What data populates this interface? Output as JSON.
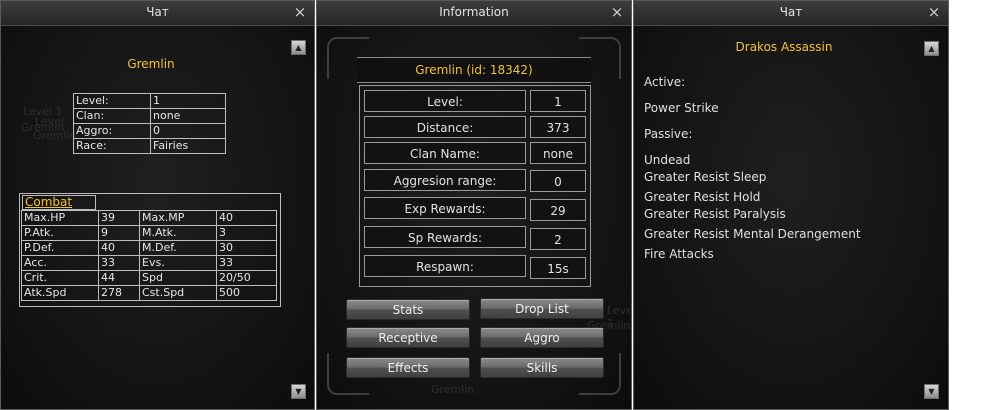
{
  "windows": {
    "left": {
      "title": "Чат",
      "close_icon": "×",
      "monster_name": "Gremlin",
      "info": [
        [
          "Level:",
          "1"
        ],
        [
          "Clan:",
          "none"
        ],
        [
          "Aggro:",
          "0"
        ],
        [
          "Race:",
          "Fairies"
        ]
      ],
      "combat_header": "Combat",
      "combat": [
        [
          "Max.HP",
          "39",
          "Max.MP",
          "40"
        ],
        [
          "P.Atk.",
          "9",
          "M.Atk.",
          "3"
        ],
        [
          "P.Def.",
          "40",
          "M.Def.",
          "30"
        ],
        [
          "Acc.",
          "33",
          "Evs.",
          "33"
        ],
        [
          "Crit.",
          "44",
          "Spd",
          "20/50"
        ],
        [
          "Atk.Spd",
          "278",
          "Cst.Spd",
          "500"
        ]
      ],
      "ghost_text": [
        "Level 1",
        "Level",
        "Gremlin",
        "Gremlin"
      ]
    },
    "middle": {
      "title": "Information",
      "header": "Gremlin (id: 18342)",
      "rows": [
        {
          "label": "Level:",
          "value": "1"
        },
        {
          "label": "Distance:",
          "value": "373"
        },
        {
          "label": "Clan Name:",
          "value": "none"
        },
        {
          "label": "Aggresion range:",
          "value": "0"
        },
        {
          "label": "Exp Rewards:",
          "value": "29"
        },
        {
          "label": "Sp Rewards:",
          "value": "2"
        },
        {
          "label": "Respawn:",
          "value": "15s"
        }
      ],
      "buttons": {
        "stats": "Stats",
        "drop_list": "Drop List",
        "receptive": "Receptive",
        "aggro": "Aggro",
        "effects": "Effects",
        "skills": "Skills"
      },
      "ghost_text": [
        "Gremlin",
        "Level 1",
        "Gremlin"
      ]
    },
    "right": {
      "title": "Чат",
      "monster_name": "Drakos Assassin",
      "lines": [
        "Active:",
        "Power Strike",
        "Passive:",
        "Undead",
        "Greater Resist Sleep",
        "Greater Resist Hold",
        "Greater Resist Paralysis",
        "Greater Resist Mental Derangement",
        "Fire Attacks"
      ]
    }
  },
  "icons": {
    "close": "close-icon",
    "scroll_up": "scroll-up-icon",
    "scroll_down": "scroll-down-icon"
  }
}
